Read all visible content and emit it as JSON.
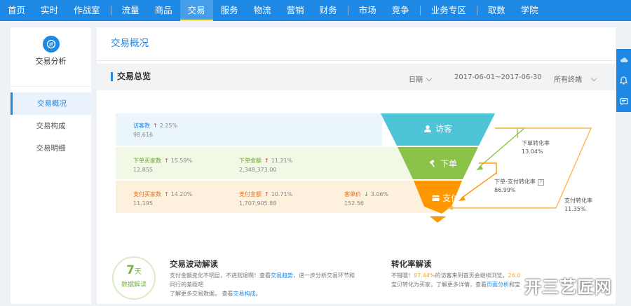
{
  "nav": {
    "items": [
      {
        "label": "首页"
      },
      {
        "label": "实时"
      },
      {
        "label": "作战室"
      },
      {
        "label": "流量"
      },
      {
        "label": "商品"
      },
      {
        "label": "交易"
      },
      {
        "label": "服务"
      },
      {
        "label": "物流"
      },
      {
        "label": "营销"
      },
      {
        "label": "财务"
      },
      {
        "label": "市场"
      },
      {
        "label": "竞争"
      },
      {
        "label": "业务专区"
      },
      {
        "label": "取数"
      },
      {
        "label": "学院"
      }
    ],
    "active": "交易"
  },
  "sidebar": {
    "title": "交易分析",
    "items": [
      {
        "label": "交易概况"
      },
      {
        "label": "交易构成"
      },
      {
        "label": "交易明细"
      }
    ]
  },
  "main": {
    "page_title": "交易概况",
    "section_title": "交易总览",
    "date_label": "日期",
    "date_range": "2017-06-01~2017-06-30",
    "terminal_label": "所有终端"
  },
  "funnel": {
    "visitors": {
      "label": "访客数",
      "change": "2.25%",
      "value": "98,616"
    },
    "order_buyers": {
      "label": "下单买家数",
      "change": "15.59%",
      "value": "12,855"
    },
    "order_amount": {
      "label": "下单金额",
      "change": "11.21%",
      "value": "2,348,373.00"
    },
    "pay_buyers": {
      "label": "支付买家数",
      "change": "14.20%",
      "value": "11,195"
    },
    "pay_amount": {
      "label": "支付金额",
      "change": "10.71%",
      "value": "1,707,905.88"
    },
    "unit_price": {
      "label": "客单价",
      "change": "3.06%",
      "value": "152.56"
    },
    "stages": {
      "visit": "访客",
      "order": "下单",
      "pay": "支付"
    },
    "rates": {
      "order_rate_label": "下单转化率",
      "order_rate": "13.04%",
      "order_pay_label": "下单-支付转化率",
      "order_pay": "86.99%",
      "pay_rate_label": "支付转化率",
      "pay_rate": "11.35%"
    },
    "colors": {
      "visit": "#4ec5d6",
      "order": "#8bc34a",
      "pay": "#ff9800",
      "visit_band": "#eaf6fb",
      "order_band": "#f1f8e6",
      "pay_band": "#fdf1de"
    }
  },
  "fluctuation": {
    "badge_number": "7",
    "badge_unit": "天",
    "badge_caption": "数据解读",
    "title": "交易波动解读",
    "line1_a": "支付金额变化不明显，不进则退啊！查看",
    "line1_link": "交易趋势",
    "line1_b": "，进一步分析交易环节和",
    "line2": "同行的差距吧",
    "line3_a": "了解更多交易数据，  查看",
    "line3_link": "交易构成",
    "line3_b": "。"
  },
  "conversion": {
    "title": "转化率解读",
    "line1_a": "不错哦！",
    "line1_pct": "97.44%",
    "line1_b": "的访客来到首页会继续浏览，",
    "line1_pct2": "26.0",
    "line2_a": "宝贝转化为买家，了解更多详情，查看",
    "line2_link": "页面分析",
    "line2_b": "和宝"
  },
  "watermark": "开三艺匠网"
}
